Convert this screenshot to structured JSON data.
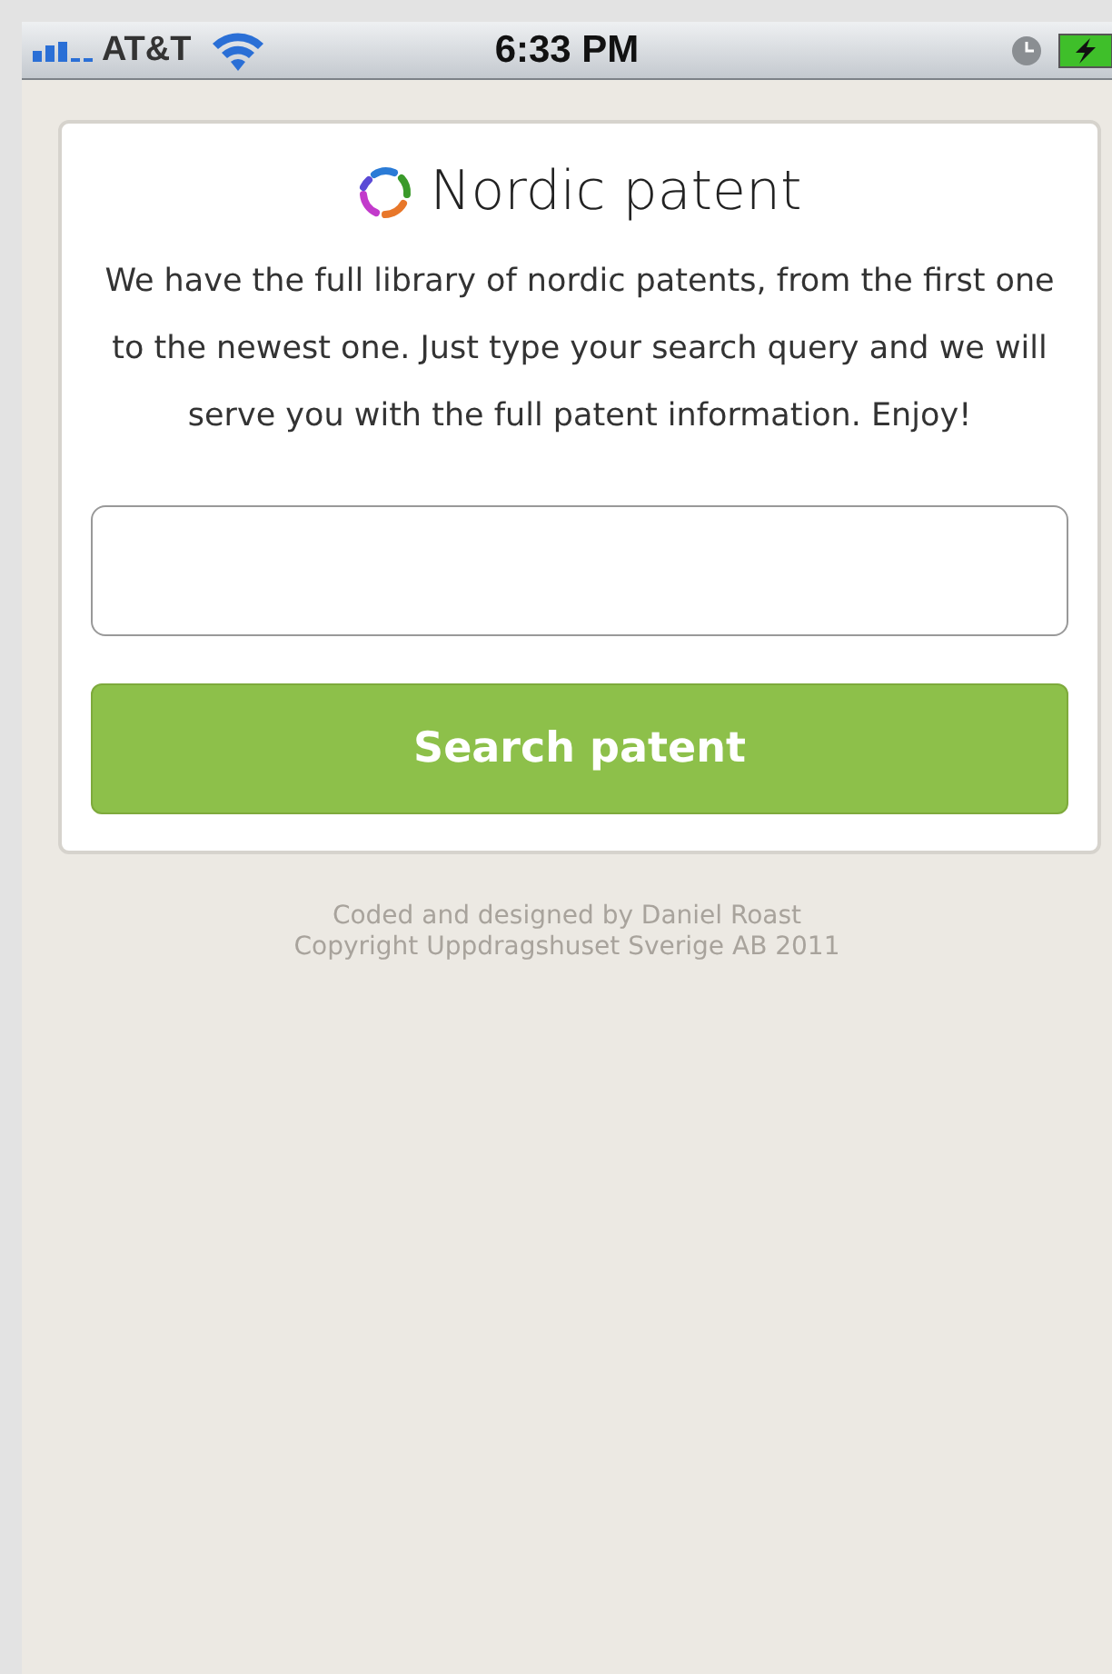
{
  "status_bar": {
    "carrier": "AT&T",
    "time": "6:33 PM"
  },
  "card": {
    "title": "Nordic patent",
    "description": "We have the full library of nordic patents, from the first one to the newest one. Just type your search query and we will serve you with the full patent information. Enjoy!",
    "button": "Search patent"
  },
  "footer": [
    "Coded and designed by Daniel Roast",
    "Copyright Uppdragshuset Sverige AB 2011"
  ]
}
